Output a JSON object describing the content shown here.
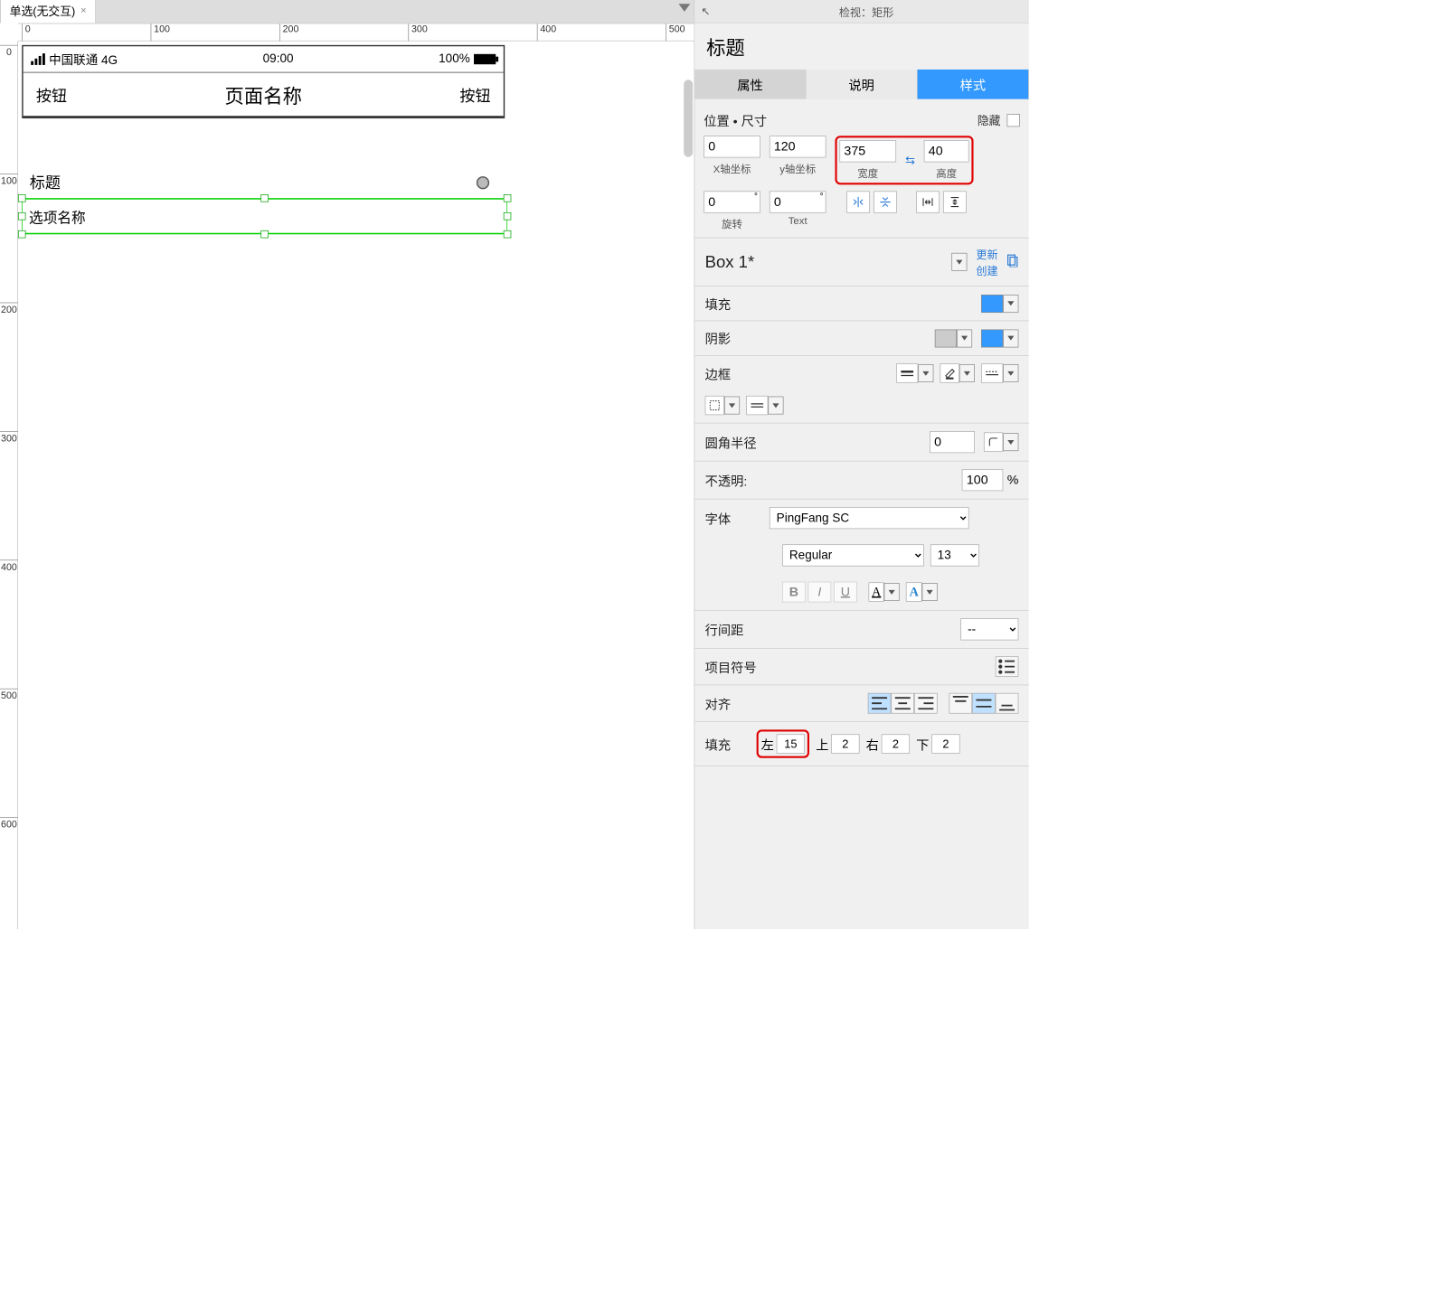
{
  "tab": {
    "title": "单选(无交互)"
  },
  "ruler": {
    "h": [
      "0",
      "100",
      "200",
      "300",
      "400",
      "500"
    ],
    "v": [
      "0",
      "100",
      "200",
      "300",
      "400",
      "500",
      "600"
    ]
  },
  "phone": {
    "carrier": "中国联通 4G",
    "time": "09:00",
    "battery": "100%",
    "nav_left": "按钮",
    "nav_title": "页面名称",
    "nav_right": "按钮",
    "section_title": "标题",
    "option_name": "选项名称"
  },
  "inspector": {
    "header": "检视：矩形",
    "title": "标题",
    "tabs": {
      "props": "属性",
      "notes": "说明",
      "style": "样式"
    },
    "pos_size": {
      "label": "位置 • 尺寸",
      "hide": "隐藏",
      "x": "0",
      "xlabel": "X轴坐标",
      "y": "120",
      "ylabel": "y轴坐标",
      "w": "375",
      "wlabel": "宽度",
      "h": "40",
      "hlabel": "高度",
      "rot": "0",
      "rotlabel": "旋转",
      "txtrot": "0",
      "txtrotlabel": "Text"
    },
    "style_name": "Box 1*",
    "style_links": {
      "update": "更新",
      "create": "创建"
    },
    "sections": {
      "fill": "填充",
      "shadow": "阴影",
      "border": "边框",
      "corner": "圆角半径",
      "corner_val": "0",
      "opacity": "不透明:",
      "opacity_val": "100",
      "opacity_unit": "%",
      "font": "字体",
      "font_family": "PingFang SC",
      "font_weight": "Regular",
      "font_size": "13",
      "line_spacing": "行间距",
      "line_spacing_val": "--",
      "bullets": "项目符号",
      "align": "对齐",
      "padding": "填充",
      "pad": {
        "l_lbl": "左",
        "l": "15",
        "t_lbl": "上",
        "t": "2",
        "r_lbl": "右",
        "r": "2",
        "b_lbl": "下",
        "b": "2"
      }
    }
  }
}
